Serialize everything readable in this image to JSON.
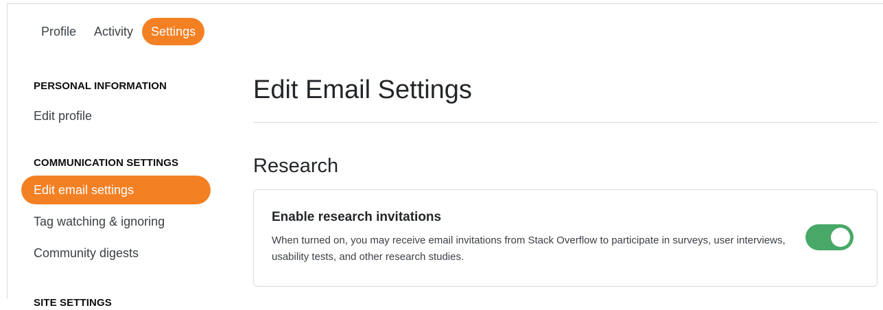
{
  "tabs": [
    {
      "label": "Profile",
      "active": false
    },
    {
      "label": "Activity",
      "active": false
    },
    {
      "label": "Settings",
      "active": true
    }
  ],
  "sidebar": {
    "personal_heading": "PERSONAL INFORMATION",
    "edit_profile": "Edit profile",
    "communication_heading": "COMMUNICATION SETTINGS",
    "edit_email_settings": "Edit email settings",
    "tag_watching": "Tag watching & ignoring",
    "community_digests": "Community digests",
    "site_heading": "SITE SETTINGS"
  },
  "main": {
    "title": "Edit Email Settings",
    "section_title": "Research",
    "card": {
      "title": "Enable research invitations",
      "description": "When turned on, you may receive email invitations from Stack Overflow to participate in surveys, user interviews, usability tests, and other research studies.",
      "toggle_on": true
    }
  },
  "colors": {
    "accent": "#f48024",
    "toggle_on": "#48a868",
    "border": "#d6d9dc"
  }
}
